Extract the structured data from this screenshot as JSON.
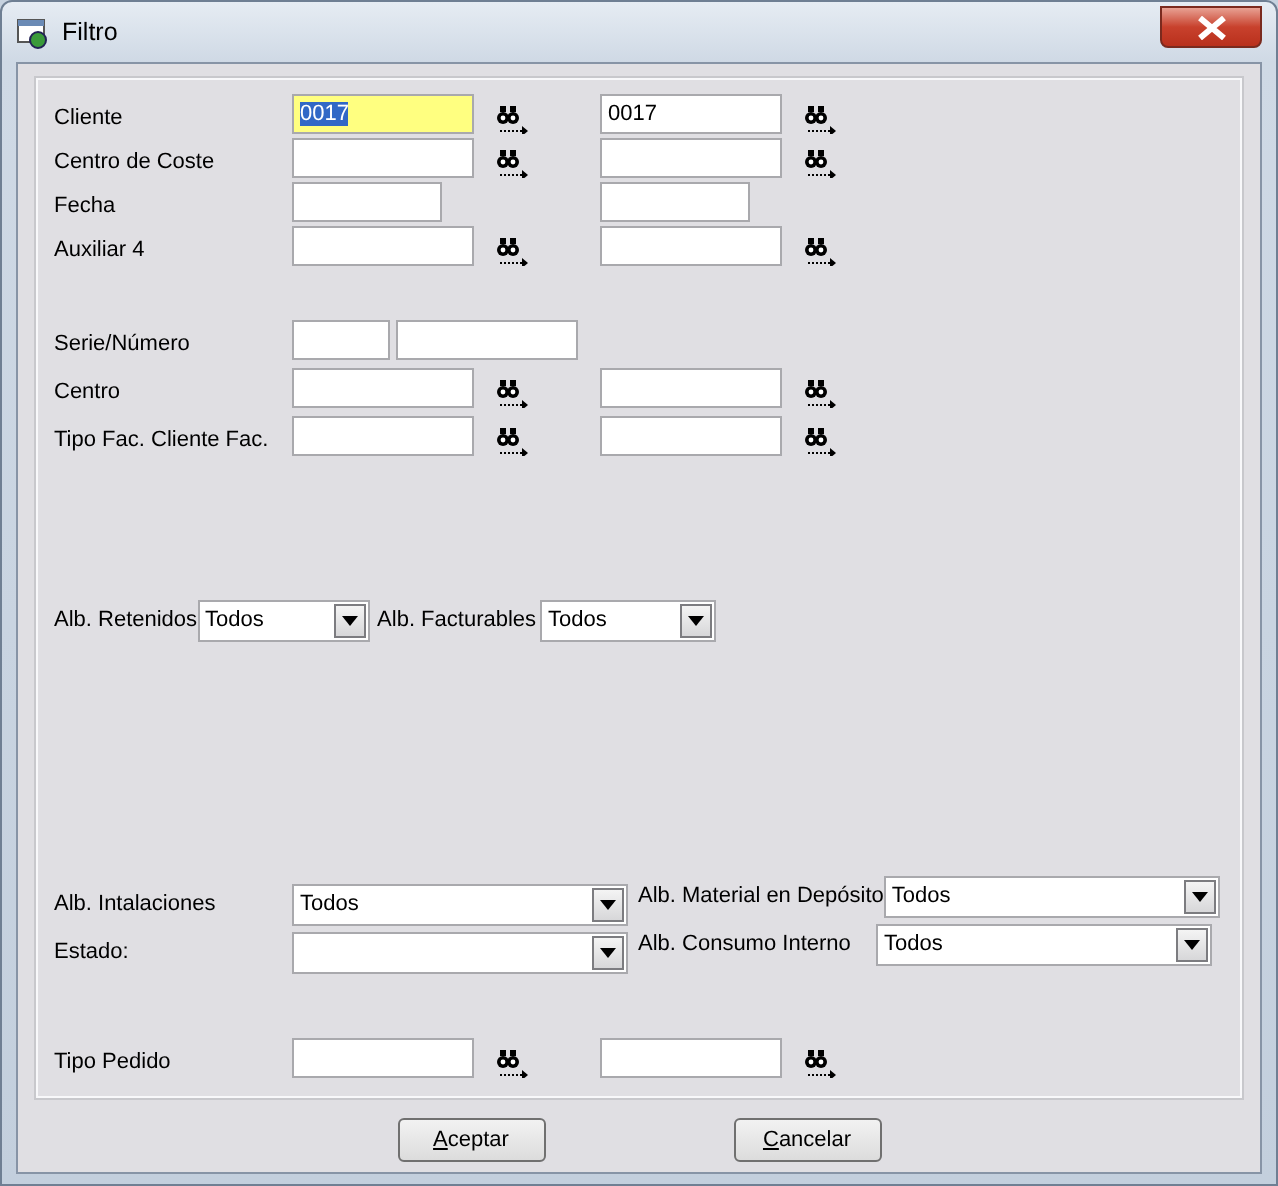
{
  "window": {
    "title": "Filtro"
  },
  "sections": [
    {
      "kind": "fields",
      "rows": [
        {
          "kind": "range",
          "label": "Cliente",
          "fields": [
            {
              "value": "0017",
              "focused": true,
              "lookup": true
            },
            {
              "value": "0017",
              "focused": false,
              "lookup": true
            }
          ]
        },
        {
          "kind": "range",
          "label": "Centro de Coste",
          "fields": [
            {
              "focused": false,
              "lookup": true
            },
            {
              "focused": false,
              "lookup": true
            }
          ]
        },
        {
          "kind": "date",
          "label": "Fecha",
          "fields": [
            {
              "focused": false,
              "lookup": false
            },
            {
              "focused": false,
              "lookup": false
            }
          ]
        },
        {
          "kind": "range",
          "label": "Auxiliar 4",
          "fields": [
            {
              "focused": false,
              "lookup": true
            },
            {
              "focused": false,
              "lookup": true
            }
          ]
        }
      ]
    },
    {
      "kind": "fields",
      "rows": [
        {
          "kind": "serie",
          "label": "Serie/Número",
          "fields": [
            {
              "focused": false,
              "lookup": false
            },
            {
              "focused": false,
              "lookup": false
            }
          ]
        },
        {
          "kind": "range",
          "label": "Centro",
          "fields": [
            {
              "focused": false,
              "lookup": true
            },
            {
              "focused": false,
              "lookup": true
            }
          ]
        },
        {
          "kind": "range",
          "label": "Tipo Fac. Cliente Fac.",
          "fields": [
            {
              "focused": false,
              "lookup": true
            },
            {
              "focused": false,
              "lookup": true
            }
          ]
        }
      ]
    },
    {
      "kind": "inline_combos",
      "combos": [
        {
          "label": "Alb. Retenidos",
          "value": "Todos"
        },
        {
          "label": "Alb. Facturables",
          "value": "Todos"
        }
      ]
    },
    {
      "kind": "combo_columns",
      "left": [
        {
          "label": "Alb. Intalaciones",
          "value": "Todos"
        },
        {
          "label": "Estado:"
        }
      ],
      "right": [
        {
          "label": "Alb. Material en Depósito",
          "value": "Todos"
        },
        {
          "label": "Alb. Consumo Interno",
          "value": "Todos"
        }
      ]
    },
    {
      "kind": "fields",
      "rows": [
        {
          "kind": "range",
          "label": "Tipo Pedido",
          "fields": [
            {
              "focused": false,
              "lookup": true
            },
            {
              "focused": false,
              "lookup": true
            }
          ]
        }
      ]
    }
  ],
  "buttons": [
    {
      "label": "Aceptar",
      "mnemonic": true
    },
    {
      "label": "Cancelar",
      "mnemonic": true
    }
  ]
}
